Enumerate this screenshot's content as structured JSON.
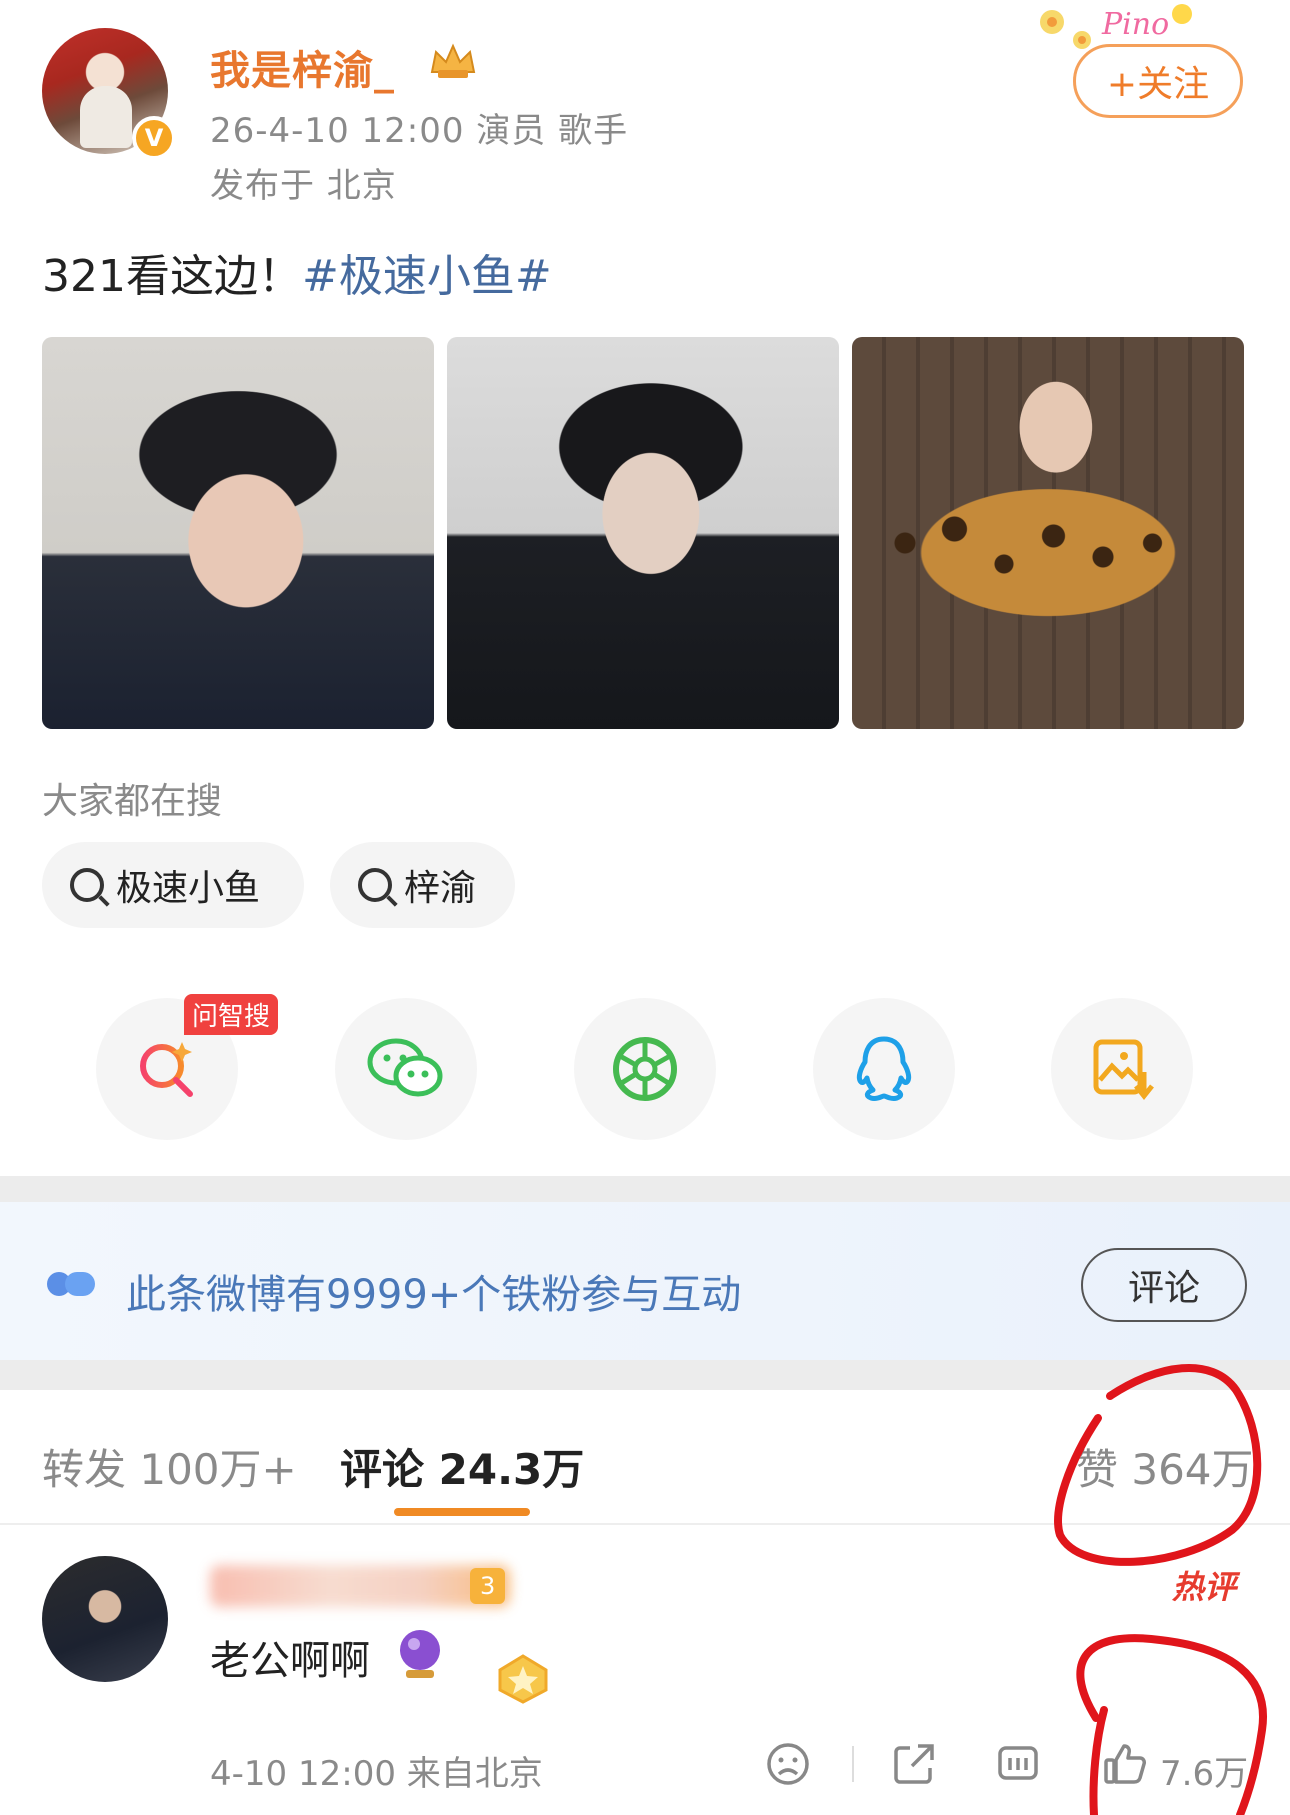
{
  "header": {
    "username": "我是梓渝_",
    "meta_line1": "26-4-10 12:00  演员 歌手",
    "meta_line2": "发布于 北京",
    "follow_label": "+关注",
    "verified_mark": "V"
  },
  "post": {
    "text": "321看这边！",
    "hashtag": "#极速小鱼#",
    "images": [
      "photo-1",
      "photo-2",
      "photo-3"
    ]
  },
  "search": {
    "title": "大家都在搜",
    "chips": [
      "极速小鱼",
      "梓渝"
    ]
  },
  "share": {
    "badge": "问智搜",
    "icons": [
      "ask-search-icon",
      "wechat-icon",
      "moments-icon",
      "qq-icon",
      "save-image-icon"
    ]
  },
  "fans": {
    "text": "此条微博有9999+个铁粉参与互动",
    "button": "评论"
  },
  "tabs": {
    "repost": "转发 100万+",
    "comment": "评论 24.3万",
    "like": "赞 364万"
  },
  "comment": {
    "level": "3",
    "hot": "热评",
    "text": "老公啊啊",
    "meta": "4-10 12:00  来自北京",
    "like_count": "7.6万"
  },
  "colors": {
    "accent_orange": "#ef7c2a",
    "link_blue": "#456a9e",
    "fans_blue": "#4a78b8",
    "annotation_red": "#e0151b"
  }
}
